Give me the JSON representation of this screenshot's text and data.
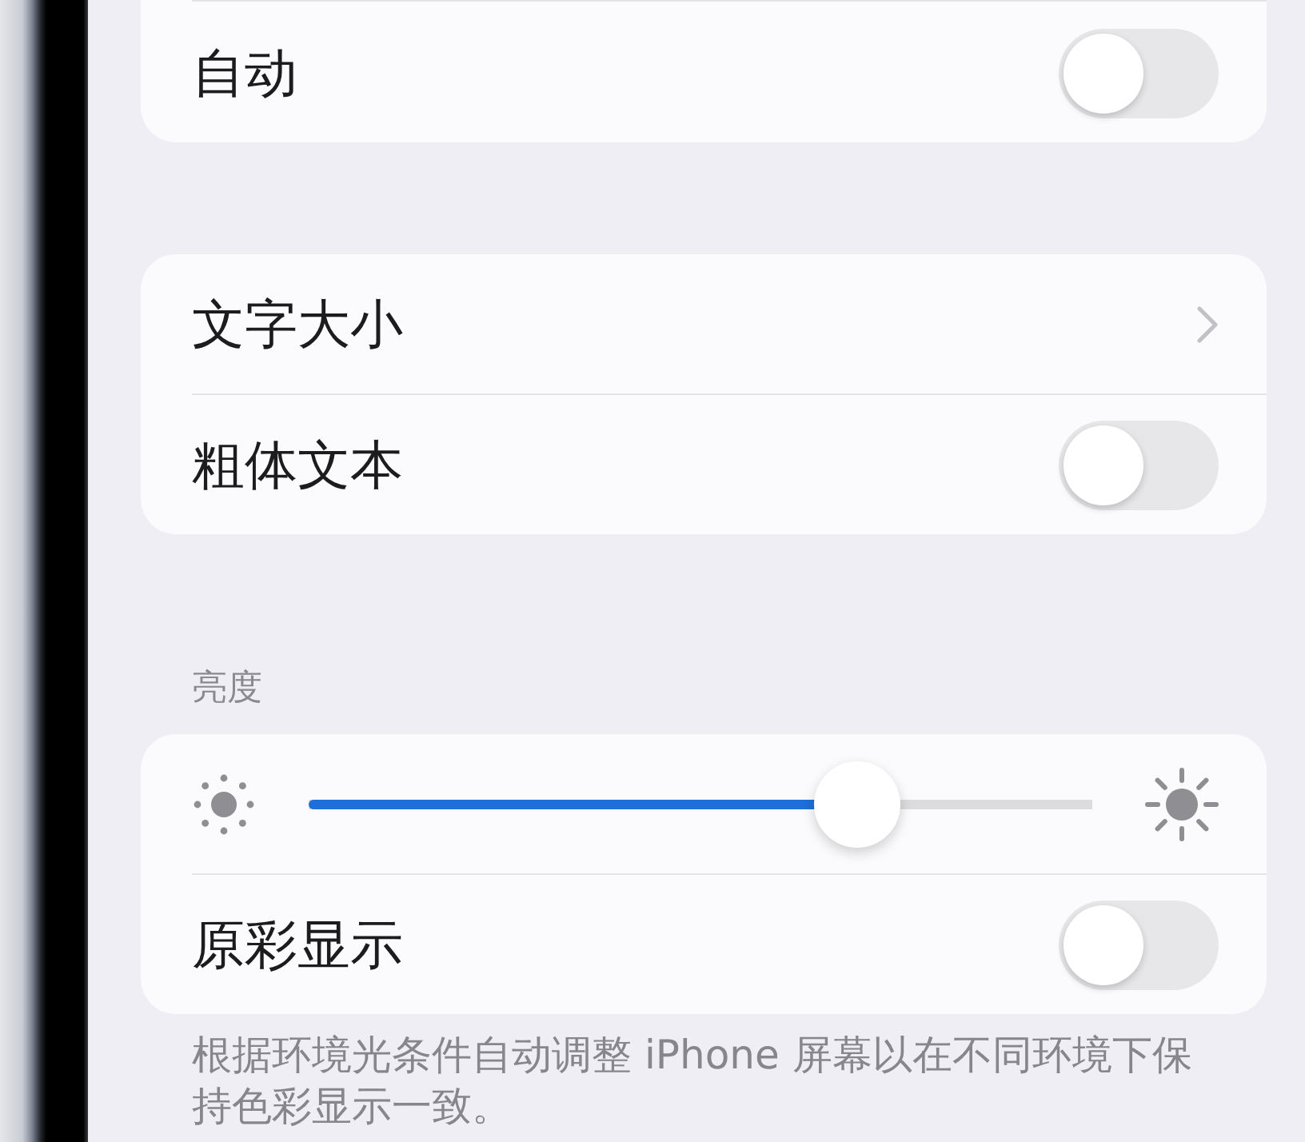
{
  "groups": [
    {
      "rows": [
        {
          "kind": "toggle",
          "label": "自动",
          "on": false
        }
      ]
    },
    {
      "rows": [
        {
          "kind": "link",
          "label": "文字大小"
        },
        {
          "kind": "toggle",
          "label": "粗体文本",
          "on": false
        }
      ]
    },
    {
      "header": "亮度",
      "rows": [
        {
          "kind": "slider",
          "level": 0.7
        },
        {
          "kind": "toggle",
          "label": "原彩显示",
          "on": false
        }
      ],
      "footer": "根据环境光条件自动调整 iPhone 屏幕以在不同环境下保持色彩显示一致。"
    }
  ]
}
